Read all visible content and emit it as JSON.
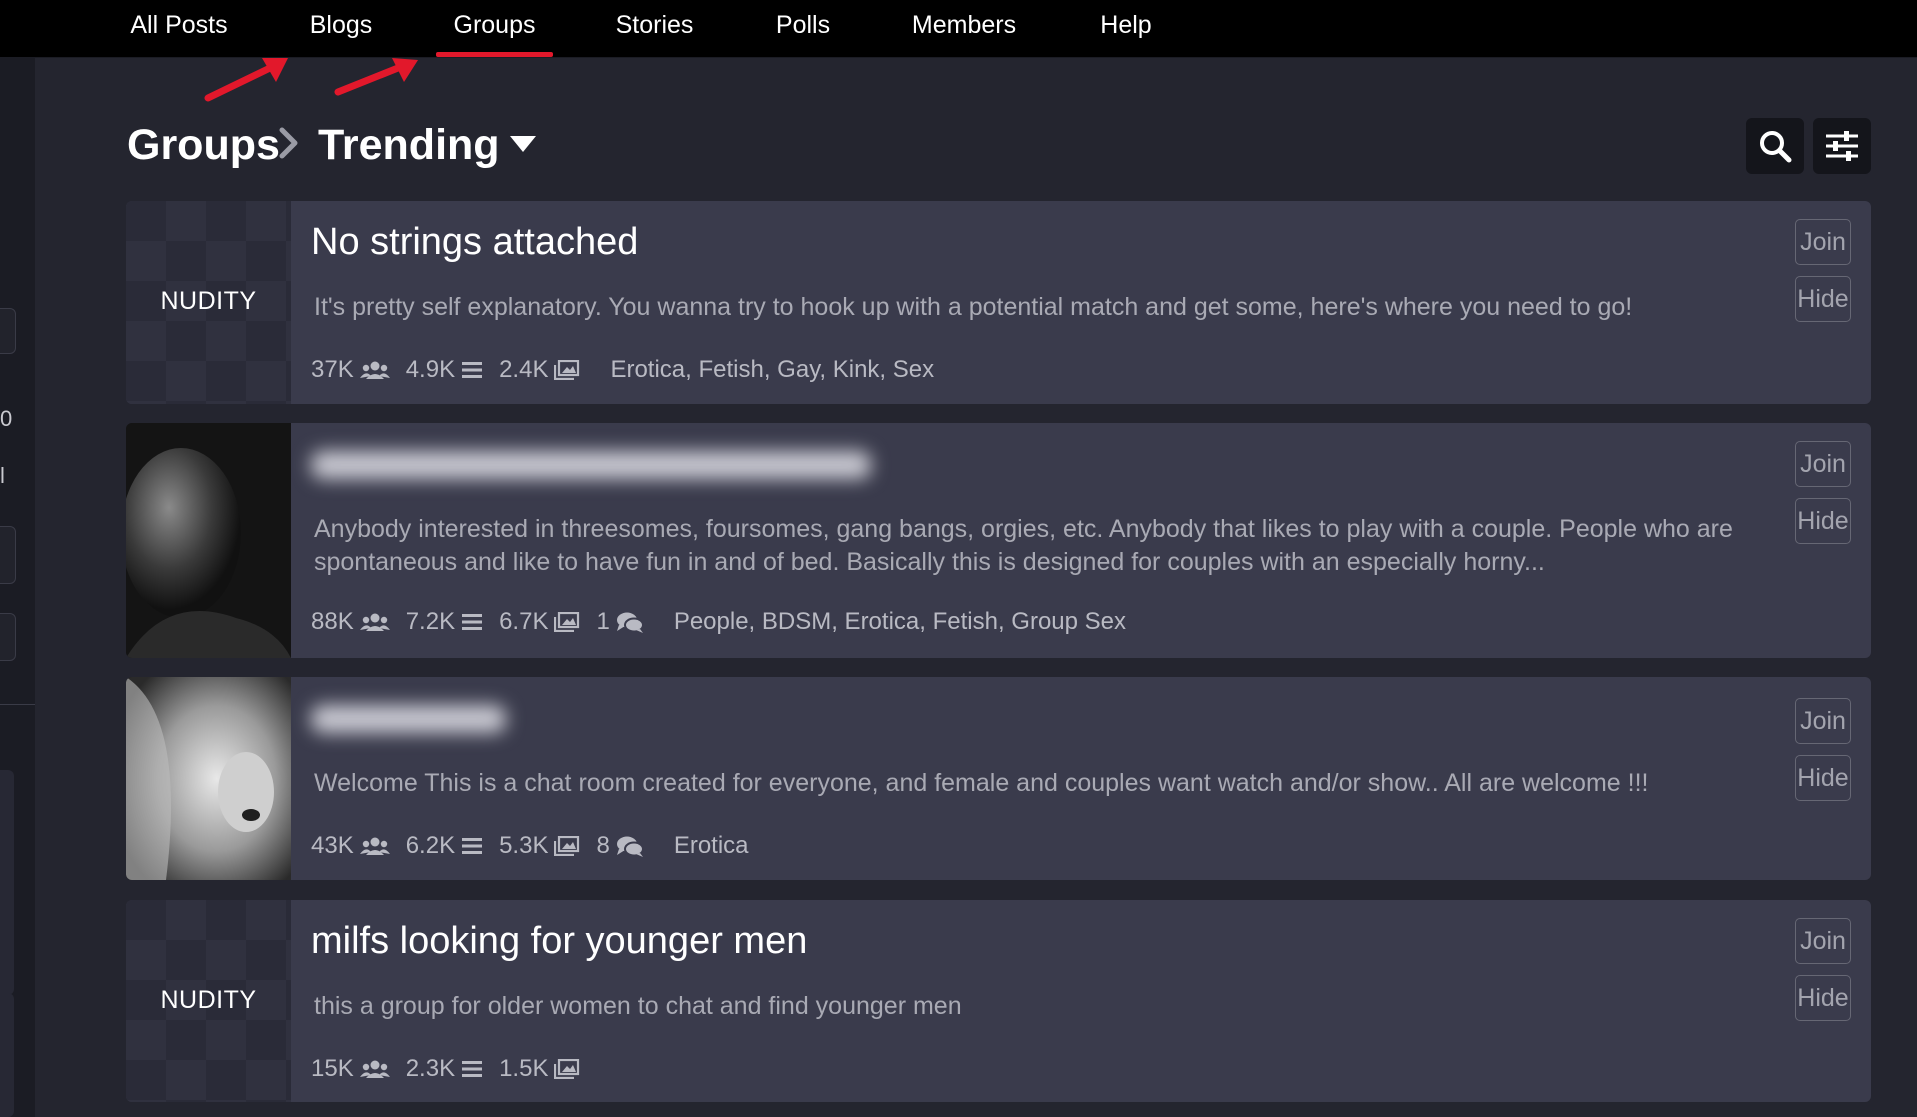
{
  "nav": {
    "tabs": [
      {
        "label": "All Posts"
      },
      {
        "label": "Blogs"
      },
      {
        "label": "Groups",
        "active": true
      },
      {
        "label": "Stories"
      },
      {
        "label": "Polls"
      },
      {
        "label": "Members"
      },
      {
        "label": "Help"
      }
    ]
  },
  "sidebar": {
    "glyph_1": "0",
    "glyph_2": "l"
  },
  "header": {
    "breadcrumb_root": "Groups",
    "breadcrumb_current": "Trending"
  },
  "cards": [
    {
      "thumb_label": "NUDITY",
      "title": "No strings attached",
      "description": "It's pretty self explanatory. You wanna try to hook up with a potential match and get some, here's where you need to go!",
      "members": "37K",
      "posts": "4.9K",
      "photos": "2.4K",
      "tags": "Erotica, Fetish, Gay, Kink, Sex",
      "join_label": "Join",
      "hide_label": "Hide"
    },
    {
      "description": "Anybody interested in threesomes, foursomes, gang bangs, orgies, etc. Anybody that likes to play with a couple. People who are spontaneous and like to have fun in and of bed. Basically this is designed for couples with an especially horny...",
      "members": "88K",
      "posts": "7.2K",
      "photos": "6.7K",
      "chats": "1",
      "tags": "People, BDSM, Erotica, Fetish, Group Sex",
      "join_label": "Join",
      "hide_label": "Hide"
    },
    {
      "description": "Welcome This is a chat room created for everyone, and female and couples want watch and/or show.. All are welcome !!!",
      "members": "43K",
      "posts": "6.2K",
      "photos": "5.3K",
      "chats": "8",
      "tags": "Erotica",
      "join_label": "Join",
      "hide_label": "Hide"
    },
    {
      "thumb_label": "NUDITY",
      "title": "milfs looking for younger men",
      "description": "this a group for older women to chat and find younger men",
      "members": "15K",
      "posts": "2.3K",
      "photos": "1.5K",
      "join_label": "Join",
      "hide_label": "Hide"
    }
  ],
  "icons": {
    "members": "users-icon",
    "posts": "list-icon",
    "photos": "image-icon",
    "chats": "chat-bubbles-icon",
    "search": "search-icon",
    "filter": "sliders-icon",
    "dropdown": "caret-down-icon",
    "breadcrumb_sep": "chevron-right-icon",
    "annotation": "red-arrow-icon"
  },
  "colors": {
    "page_bg": "#24252f",
    "nav_bg": "#000000",
    "card_bg": "#3a3b4c",
    "accent": "#e2182b"
  }
}
